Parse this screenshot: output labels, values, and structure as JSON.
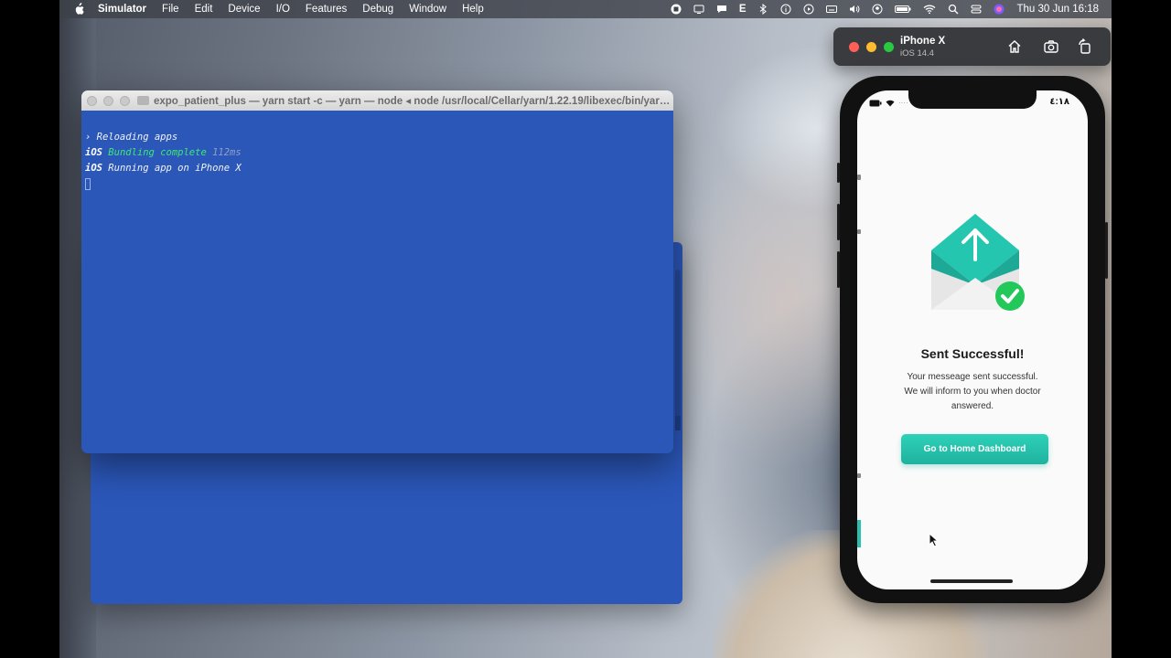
{
  "menubar": {
    "app_name": "Simulator",
    "items": [
      "File",
      "Edit",
      "Device",
      "I/O",
      "Features",
      "Debug",
      "Window",
      "Help"
    ],
    "status_e": "E",
    "clock": "Thu 30 Jun  16:18"
  },
  "terminal": {
    "title": "expo_patient_plus — yarn start -c — yarn — node ◂ node /usr/local/Cellar/yarn/1.22.19/libexec/bin/yarn.js start -...",
    "lines": {
      "reloading": "› Reloading apps",
      "platform": "iOS",
      "bundling": "Bundling complete",
      "bundle_time": "112ms",
      "running": "Running app on iPhone X"
    }
  },
  "simulator": {
    "device_name": "iPhone X",
    "device_os": "iOS 14.4"
  },
  "phone": {
    "status_time": "٤:١٨",
    "headline": "Sent Successful!",
    "message_lines": [
      "Your messeage sent successful.",
      "We will inform to you when doctor",
      "answered."
    ],
    "button_label": "Go to Home Dashboard"
  },
  "colors": {
    "accent": "#22c3ad",
    "check_green": "#22c95a",
    "terminal_bg": "#2b57b9"
  },
  "icons": {
    "apple": "apple-icon",
    "home": "home-icon",
    "screenshot": "camera-icon",
    "rotate": "rotate-icon",
    "envelope": "envelope-icon",
    "check": "checkmark-icon"
  }
}
